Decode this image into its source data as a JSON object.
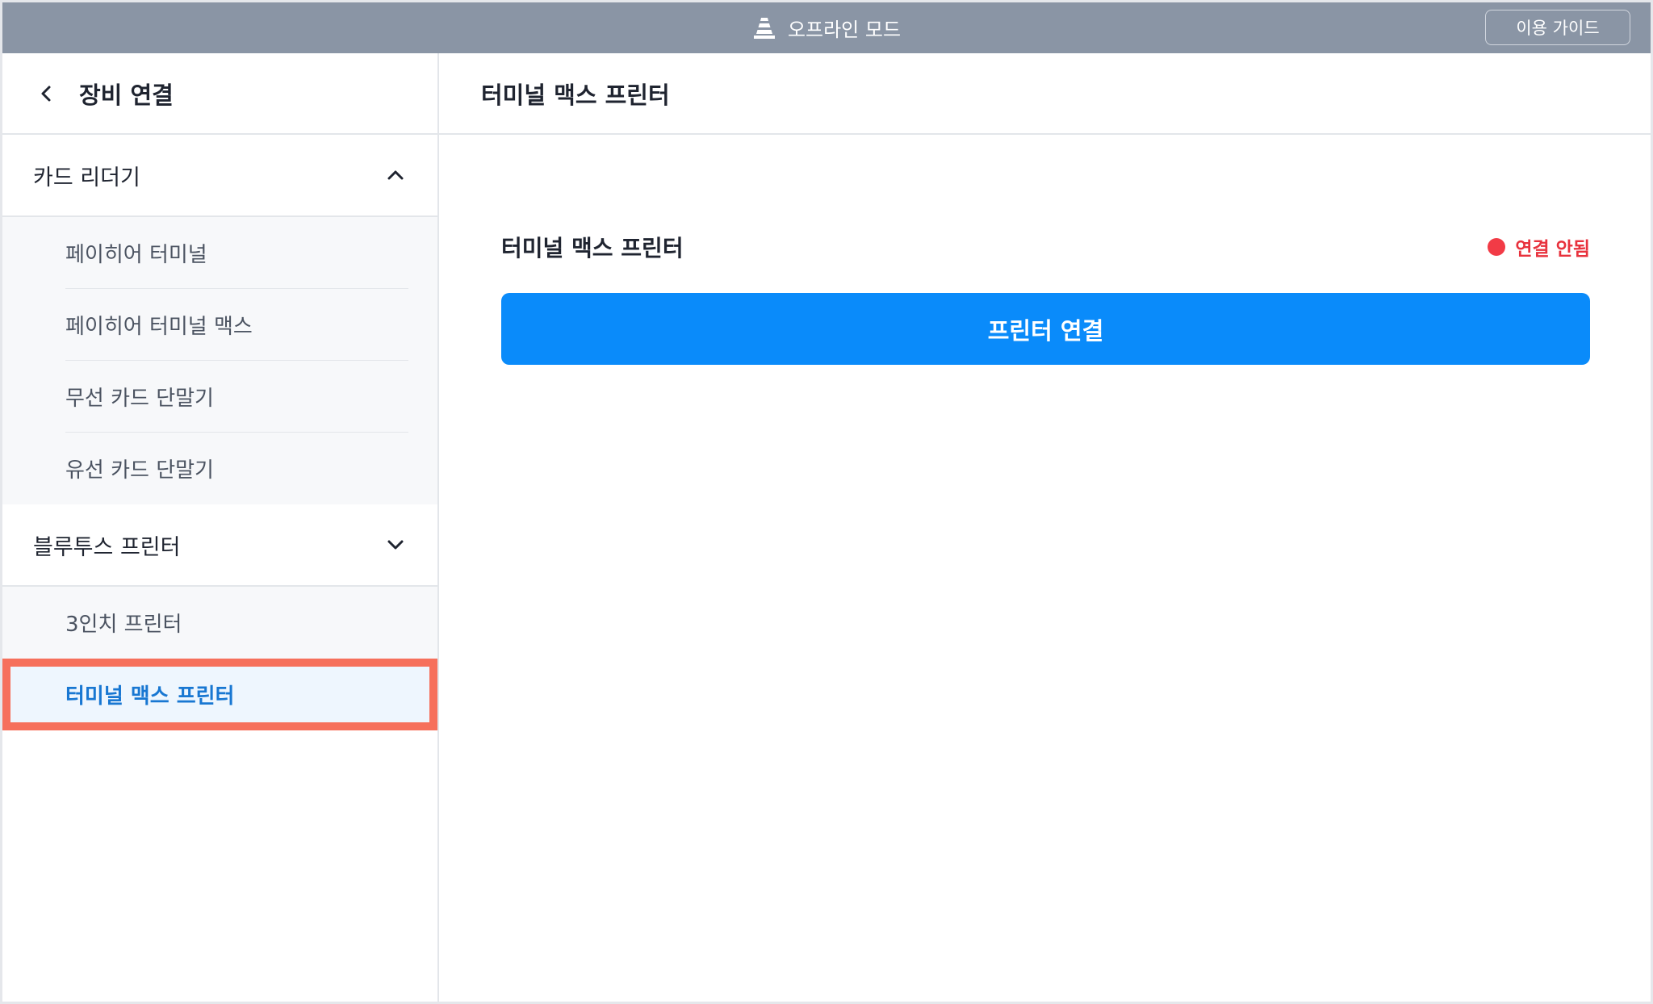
{
  "topbar": {
    "mode_label": "오프라인 모드",
    "guide_button": "이용 가이드",
    "mode_icon": "traffic-cone-icon"
  },
  "sidebar": {
    "title": "장비 연결",
    "groups": [
      {
        "label": "카드 리더기",
        "expanded": true,
        "items": [
          {
            "label": "페이히어 터미널"
          },
          {
            "label": "페이히어 터미널 맥스"
          },
          {
            "label": "무선 카드 단말기"
          },
          {
            "label": "유선 카드 단말기"
          }
        ]
      },
      {
        "label": "블루투스 프린터",
        "expanded": true,
        "items": [
          {
            "label": "3인치 프린터"
          },
          {
            "label": "터미널 맥스 프린터",
            "selected": true
          }
        ]
      }
    ]
  },
  "main": {
    "title": "터미널 맥스 프린터",
    "device_name": "터미널 맥스 프린터",
    "status_text": "연결 안됨",
    "connect_button": "프린터 연결"
  },
  "colors": {
    "topbar": "#8a95a5",
    "accent_blue": "#0a8bfa",
    "selected_text": "#1877d2",
    "status_red": "#f23b46",
    "highlight_border": "#f6705c"
  }
}
